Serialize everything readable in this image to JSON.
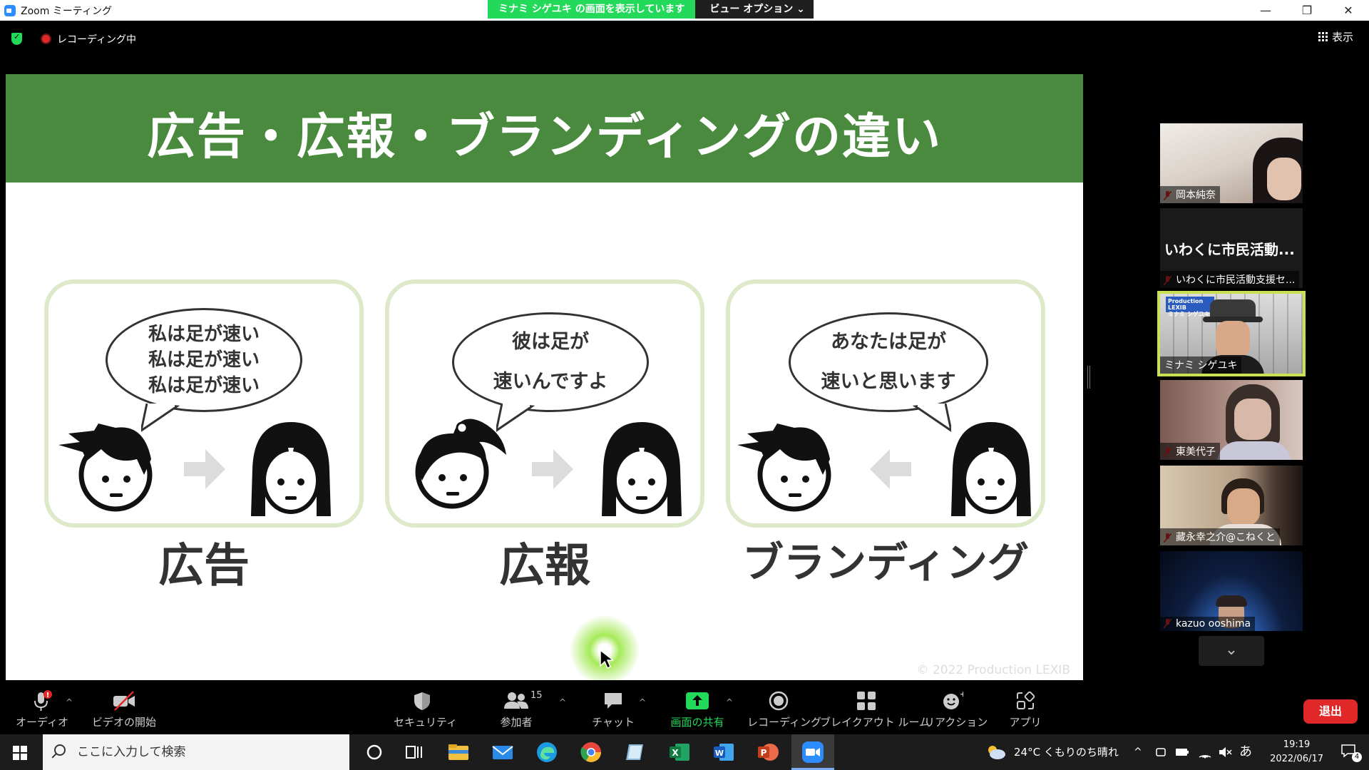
{
  "window": {
    "title": "Zoom ミーティング",
    "sharing_banner": "ミナミ シゲユキ の画面を表示しています",
    "view_options": "ビュー オプション ⌄",
    "minimize": "—",
    "restore": "❐",
    "close": "✕"
  },
  "status": {
    "recording_label": "レコーディング中",
    "view_label": "表示"
  },
  "slide": {
    "title": "広告・広報・ブランディングの違い",
    "panels": [
      {
        "lines": [
          "私は足が速い",
          "私は足が速い",
          "私は足が速い"
        ],
        "caption": "広告"
      },
      {
        "lines": [
          "彼は足が",
          "速いんですよ"
        ],
        "caption": "広報"
      },
      {
        "lines": [
          "あなたは足が",
          "速いと思います"
        ],
        "caption": "ブランディング"
      }
    ],
    "watermark": "© 2022 Production LEXIB"
  },
  "participants": [
    {
      "name": "岡本純奈",
      "bg": "#b9a79a"
    },
    {
      "name": "いわくに市民活動支援セ...",
      "display_text": "いわくに市民活動...",
      "bg": "#1a1a1a"
    },
    {
      "name": "ミナミ シゲユキ",
      "bg": "#c8c8c8",
      "active": true
    },
    {
      "name": "東美代子",
      "bg": "#9a7a70"
    },
    {
      "name": "藏永幸之介@こねくと",
      "bg": "#8a7563"
    },
    {
      "name": "kazuo ooshima",
      "bg": "#0f1f3a"
    }
  ],
  "scroll_down": "⌄",
  "toolbar": {
    "audio": "オーディオ",
    "video": "ビデオの開始",
    "security": "セキュリティ",
    "participants": "参加者",
    "participants_count": "15",
    "chat": "チャット",
    "share": "画面の共有",
    "recording": "レコーディング",
    "breakout": "ブレイクアウト ルーム",
    "reaction": "リアクション",
    "apps": "アプリ",
    "leave": "退出",
    "caret": "^"
  },
  "taskbar": {
    "search_placeholder": "ここに入力して検索",
    "weather": "24°C くもりのち晴れ",
    "ime": "あ",
    "time": "19:19",
    "date": "2022/06/17",
    "notification_count": "4"
  },
  "colors": {
    "zoom_green": "#23d959",
    "slide_green": "#4a8a3f",
    "leave_red": "#e02828",
    "active_speaker": "#c9e255"
  }
}
